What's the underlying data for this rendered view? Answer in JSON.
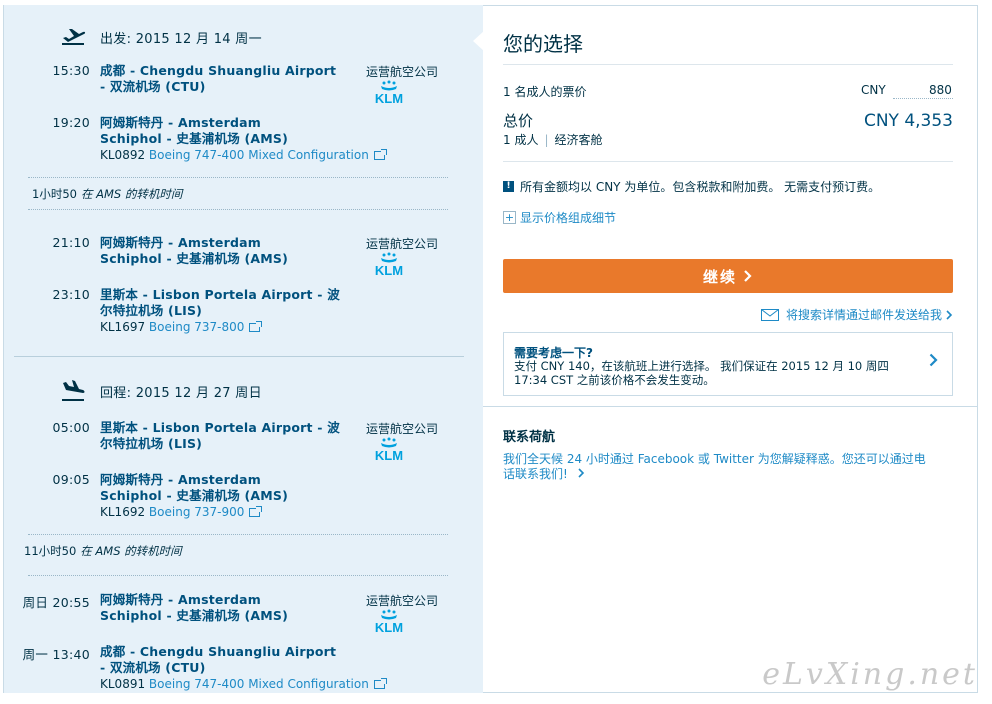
{
  "outbound": {
    "header": "出发: 2015 12 月 14 周一",
    "seg1": {
      "dep_time": "15:30",
      "dep_place": "成都 - Chengdu Shuangliu Airport - 双流机场 (CTU)",
      "arr_time": "19:20",
      "arr_place": "阿姆斯特丹 - Amsterdam Schiphol - 史基浦机场 (AMS)",
      "flight_no": "KL0892",
      "aircraft": "Boeing 747-400 Mixed Configuration",
      "operator_label": "运营航空公司"
    },
    "layover": {
      "duration": "1小时50",
      "text": "在 AMS 的转机时间"
    },
    "seg2": {
      "dep_time": "21:10",
      "dep_place": "阿姆斯特丹 - Amsterdam Schiphol - 史基浦机场 (AMS)",
      "arr_time": "23:10",
      "arr_place": "里斯本 - Lisbon Portela Airport - 波尔特拉机场 (LIS)",
      "flight_no": "KL1697",
      "aircraft": "Boeing 737-800",
      "operator_label": "运营航空公司"
    }
  },
  "return": {
    "header": "回程: 2015 12 月 27 周日",
    "seg1": {
      "dep_time": "05:00",
      "dep_place": "里斯本 - Lisbon Portela Airport - 波尔特拉机场 (LIS)",
      "arr_time": "09:05",
      "arr_place": "阿姆斯特丹 - Amsterdam Schiphol - 史基浦机场 (AMS)",
      "flight_no": "KL1692",
      "aircraft": "Boeing 737-900",
      "operator_label": "运营航空公司"
    },
    "layover": {
      "duration": "11小时50",
      "text": "在 AMS 的转机时间"
    },
    "seg2": {
      "dep_day": "周日",
      "dep_time": "20:55",
      "dep_place": "阿姆斯特丹 - Amsterdam Schiphol - 史基浦机场 (AMS)",
      "arr_day": "周一",
      "arr_time": "13:40",
      "arr_place": "成都 - Chengdu Shuangliu Airport - 双流机场 (CTU)",
      "flight_no": "KL0891",
      "aircraft": "Boeing 747-400 Mixed Configuration",
      "operator_label": "运营航空公司"
    }
  },
  "airline_logo_text": "KLM",
  "summary": {
    "title": "您的选择",
    "per_adult_label": "1 名成人的票价",
    "per_adult_currency": "CNY",
    "per_adult_amount": "880",
    "total_label": "总价",
    "pax_label": "1 成人",
    "cabin_label": "经济客舱",
    "total_value": "CNY 4,353",
    "notice": "所有金额均以 CNY 为单位。包含税款和附加费。 无需支付预订费。",
    "breakdown_link": "显示价格组成细节",
    "continue_button": "继续",
    "email_link": "将搜索详情通过邮件发送给我",
    "hold_title": "需要考虑一下?",
    "hold_text": "支付 CNY 140，在该航班上进行选择。 我们保证在 2015 12 月 10 周四 17:34 CST 之前该价格不会发生变动。"
  },
  "contact": {
    "title": "联系荷航",
    "text": "我们全天候 24 小时通过 Facebook 或 Twitter 为您解疑释惑。您还可以通过电话联系我们!"
  },
  "watermark": "eLvXing.net",
  "colors": {
    "accent": "#e9792b",
    "link": "#1e8ac6",
    "panel": "#e6f1f9",
    "text": "#003145"
  }
}
